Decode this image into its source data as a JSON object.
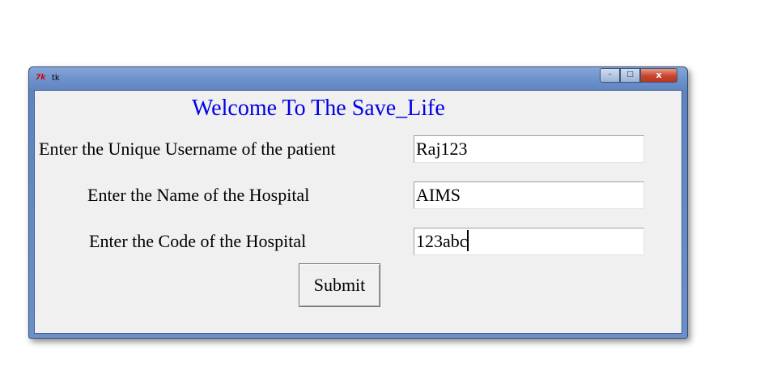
{
  "window": {
    "title": "tk",
    "icon_text": "7k",
    "controls": {
      "minimize": "–",
      "maximize": "□",
      "close": "x"
    }
  },
  "form": {
    "heading": "Welcome To The Save_Life",
    "fields": [
      {
        "label": "Enter the Unique Username of the patient",
        "value": "Raj123"
      },
      {
        "label": "Enter the Name of the Hospital",
        "value": "AIMS"
      },
      {
        "label": "Enter the Code of the Hospital",
        "value": "123abc"
      }
    ],
    "submit_label": "Submit"
  },
  "colors": {
    "heading": "#0000e6",
    "window_frame": "#6f93cc",
    "client_background": "#f0f0f0",
    "close_button": "#c8452f"
  }
}
